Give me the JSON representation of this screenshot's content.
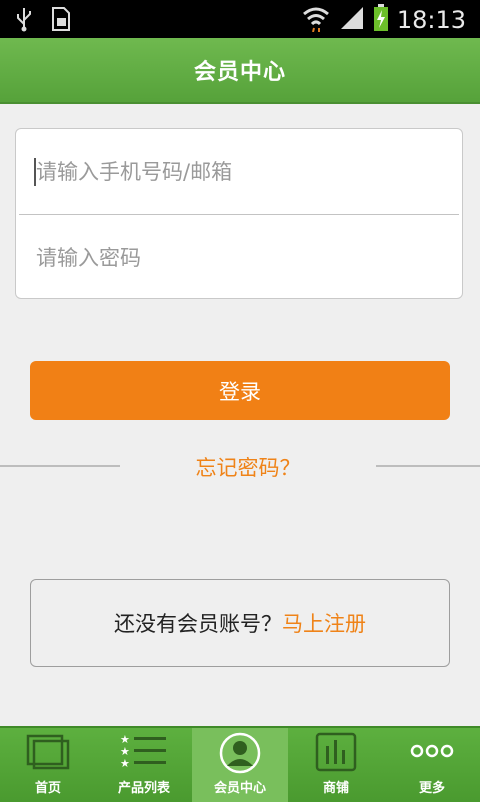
{
  "status_bar": {
    "time": "18:13"
  },
  "header": {
    "title": "会员中心"
  },
  "login_form": {
    "phone_placeholder": "请输入手机号码/邮箱",
    "password_placeholder": "请输入密码"
  },
  "login_button": "登录",
  "forgot_password": "忘记密码？",
  "register": {
    "prompt": "还没有会员账号？",
    "link": "马上注册"
  },
  "bottom_nav": {
    "items": [
      {
        "label": "首页",
        "icon": "home-icon"
      },
      {
        "label": "产品列表",
        "icon": "product-list-icon"
      },
      {
        "label": "会员中心",
        "icon": "member-icon",
        "active": true
      },
      {
        "label": "商铺",
        "icon": "shop-icon"
      },
      {
        "label": "更多",
        "icon": "more-icon"
      }
    ]
  },
  "colors": {
    "green": "#56a23a",
    "orange": "#f18015"
  }
}
